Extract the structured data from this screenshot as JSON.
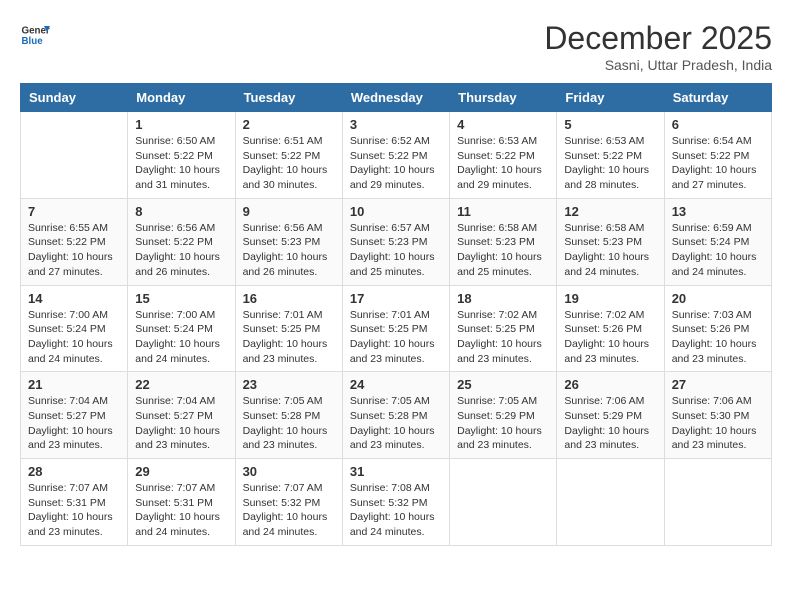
{
  "header": {
    "logo_line1": "General",
    "logo_line2": "Blue",
    "month": "December 2025",
    "location": "Sasni, Uttar Pradesh, India"
  },
  "weekdays": [
    "Sunday",
    "Monday",
    "Tuesday",
    "Wednesday",
    "Thursday",
    "Friday",
    "Saturday"
  ],
  "weeks": [
    [
      {
        "day": "",
        "sunrise": "",
        "sunset": "",
        "daylight": ""
      },
      {
        "day": "1",
        "sunrise": "6:50 AM",
        "sunset": "5:22 PM",
        "daylight": "10 hours and 31 minutes."
      },
      {
        "day": "2",
        "sunrise": "6:51 AM",
        "sunset": "5:22 PM",
        "daylight": "10 hours and 30 minutes."
      },
      {
        "day": "3",
        "sunrise": "6:52 AM",
        "sunset": "5:22 PM",
        "daylight": "10 hours and 29 minutes."
      },
      {
        "day": "4",
        "sunrise": "6:53 AM",
        "sunset": "5:22 PM",
        "daylight": "10 hours and 29 minutes."
      },
      {
        "day": "5",
        "sunrise": "6:53 AM",
        "sunset": "5:22 PM",
        "daylight": "10 hours and 28 minutes."
      },
      {
        "day": "6",
        "sunrise": "6:54 AM",
        "sunset": "5:22 PM",
        "daylight": "10 hours and 27 minutes."
      }
    ],
    [
      {
        "day": "7",
        "sunrise": "6:55 AM",
        "sunset": "5:22 PM",
        "daylight": "10 hours and 27 minutes."
      },
      {
        "day": "8",
        "sunrise": "6:56 AM",
        "sunset": "5:22 PM",
        "daylight": "10 hours and 26 minutes."
      },
      {
        "day": "9",
        "sunrise": "6:56 AM",
        "sunset": "5:23 PM",
        "daylight": "10 hours and 26 minutes."
      },
      {
        "day": "10",
        "sunrise": "6:57 AM",
        "sunset": "5:23 PM",
        "daylight": "10 hours and 25 minutes."
      },
      {
        "day": "11",
        "sunrise": "6:58 AM",
        "sunset": "5:23 PM",
        "daylight": "10 hours and 25 minutes."
      },
      {
        "day": "12",
        "sunrise": "6:58 AM",
        "sunset": "5:23 PM",
        "daylight": "10 hours and 24 minutes."
      },
      {
        "day": "13",
        "sunrise": "6:59 AM",
        "sunset": "5:24 PM",
        "daylight": "10 hours and 24 minutes."
      }
    ],
    [
      {
        "day": "14",
        "sunrise": "7:00 AM",
        "sunset": "5:24 PM",
        "daylight": "10 hours and 24 minutes."
      },
      {
        "day": "15",
        "sunrise": "7:00 AM",
        "sunset": "5:24 PM",
        "daylight": "10 hours and 24 minutes."
      },
      {
        "day": "16",
        "sunrise": "7:01 AM",
        "sunset": "5:25 PM",
        "daylight": "10 hours and 23 minutes."
      },
      {
        "day": "17",
        "sunrise": "7:01 AM",
        "sunset": "5:25 PM",
        "daylight": "10 hours and 23 minutes."
      },
      {
        "day": "18",
        "sunrise": "7:02 AM",
        "sunset": "5:25 PM",
        "daylight": "10 hours and 23 minutes."
      },
      {
        "day": "19",
        "sunrise": "7:02 AM",
        "sunset": "5:26 PM",
        "daylight": "10 hours and 23 minutes."
      },
      {
        "day": "20",
        "sunrise": "7:03 AM",
        "sunset": "5:26 PM",
        "daylight": "10 hours and 23 minutes."
      }
    ],
    [
      {
        "day": "21",
        "sunrise": "7:04 AM",
        "sunset": "5:27 PM",
        "daylight": "10 hours and 23 minutes."
      },
      {
        "day": "22",
        "sunrise": "7:04 AM",
        "sunset": "5:27 PM",
        "daylight": "10 hours and 23 minutes."
      },
      {
        "day": "23",
        "sunrise": "7:05 AM",
        "sunset": "5:28 PM",
        "daylight": "10 hours and 23 minutes."
      },
      {
        "day": "24",
        "sunrise": "7:05 AM",
        "sunset": "5:28 PM",
        "daylight": "10 hours and 23 minutes."
      },
      {
        "day": "25",
        "sunrise": "7:05 AM",
        "sunset": "5:29 PM",
        "daylight": "10 hours and 23 minutes."
      },
      {
        "day": "26",
        "sunrise": "7:06 AM",
        "sunset": "5:29 PM",
        "daylight": "10 hours and 23 minutes."
      },
      {
        "day": "27",
        "sunrise": "7:06 AM",
        "sunset": "5:30 PM",
        "daylight": "10 hours and 23 minutes."
      }
    ],
    [
      {
        "day": "28",
        "sunrise": "7:07 AM",
        "sunset": "5:31 PM",
        "daylight": "10 hours and 23 minutes."
      },
      {
        "day": "29",
        "sunrise": "7:07 AM",
        "sunset": "5:31 PM",
        "daylight": "10 hours and 24 minutes."
      },
      {
        "day": "30",
        "sunrise": "7:07 AM",
        "sunset": "5:32 PM",
        "daylight": "10 hours and 24 minutes."
      },
      {
        "day": "31",
        "sunrise": "7:08 AM",
        "sunset": "5:32 PM",
        "daylight": "10 hours and 24 minutes."
      },
      {
        "day": "",
        "sunrise": "",
        "sunset": "",
        "daylight": ""
      },
      {
        "day": "",
        "sunrise": "",
        "sunset": "",
        "daylight": ""
      },
      {
        "day": "",
        "sunrise": "",
        "sunset": "",
        "daylight": ""
      }
    ]
  ]
}
